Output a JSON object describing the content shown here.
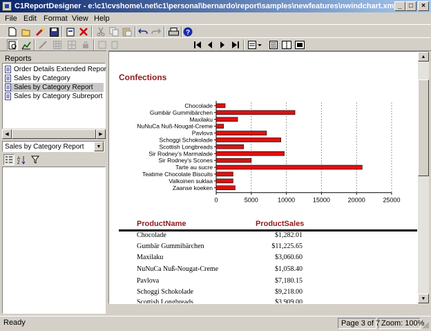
{
  "window": {
    "title": "C1ReportDesigner - e:\\c1\\cvshome\\.net\\c1\\personal\\bernardo\\report\\samples\\newfeatures\\nwindchart.xml *",
    "controls": {
      "minimize": "_",
      "maximize": "□",
      "close": "×"
    }
  },
  "menu": [
    "File",
    "Edit",
    "Format",
    "View",
    "Help"
  ],
  "toolbar1": {
    "icons": [
      "new-icon",
      "open-icon",
      "wizard-icon",
      "save-icon",
      "new-report-icon",
      "delete-icon",
      "cut-icon",
      "copy-icon",
      "paste-icon",
      "undo-icon",
      "redo-icon",
      "print-icon",
      "help-icon"
    ]
  },
  "toolbar2": {
    "icons": [
      "preview-icon",
      "chart-icon",
      "field-icon",
      "grid-icon",
      "grid2-icon",
      "lock-icon",
      "align-icon",
      "align2-icon"
    ],
    "nav": [
      "first-page-icon",
      "prev-page-icon",
      "next-page-icon",
      "last-page-icon"
    ],
    "view": [
      "page-layout-icon",
      "single-page-icon",
      "two-pages-icon",
      "multi-page-icon"
    ]
  },
  "reports": {
    "header": "Reports",
    "items": [
      {
        "label": "Order Details Extended Report",
        "selected": false
      },
      {
        "label": "Sales by Category",
        "selected": false
      },
      {
        "label": "Sales by Category Report",
        "selected": true
      },
      {
        "label": "Sales by Category Subreport",
        "selected": false
      }
    ]
  },
  "properties": {
    "combo_value": "Sales by Category Report",
    "icons": [
      "categorized-icon",
      "alphabetical-icon",
      "filter-icon"
    ]
  },
  "preview": {
    "section_title": "Confections",
    "table": {
      "headers": [
        "ProductName",
        "ProductSales"
      ],
      "rows": [
        [
          "Chocolade",
          "$1,282.01"
        ],
        [
          "Gumbär Gummibärchen",
          "$11,225.65"
        ],
        [
          "Maxilaku",
          "$3,060.60"
        ],
        [
          "NuNuCa Nuß-Nougat-Creme",
          "$1,058.40"
        ],
        [
          "Pavlova",
          "$7,180.15"
        ],
        [
          "Schoggi Schokolade",
          "$9,218.00"
        ],
        [
          "Scottish Longbreads",
          "$3,909.00"
        ]
      ]
    }
  },
  "chart_data": {
    "type": "bar",
    "orientation": "horizontal",
    "categories": [
      "Chocolade",
      "Gumbär Gummibärchen",
      "Maxilaku",
      "NuNuCa Nuß-Nougat-Creme",
      "Pavlova",
      "Schoggi Schokolade",
      "Scottish Longbreads",
      "Sir Rodney's Marmalade",
      "Sir Rodney's Scones",
      "Tarte au sucre",
      "Teatime Chocolate Biscuits",
      "Valkoinen suklaa",
      "Zaanse koeken"
    ],
    "values": [
      1282,
      11226,
      3061,
      1058,
      7180,
      9218,
      3909,
      9700,
      5000,
      20800,
      2400,
      2400,
      2700
    ],
    "xlim": [
      0,
      25000
    ],
    "xticks": [
      "0",
      "5000",
      "10000",
      "15000",
      "20000",
      "25000"
    ],
    "grid": "vertical dashed",
    "bar_color": "#dd1111",
    "title": "",
    "xlabel": "",
    "ylabel": ""
  },
  "status": {
    "left": "Ready",
    "page": "Page 3 of 7",
    "zoom": "Zoom: 100%"
  }
}
